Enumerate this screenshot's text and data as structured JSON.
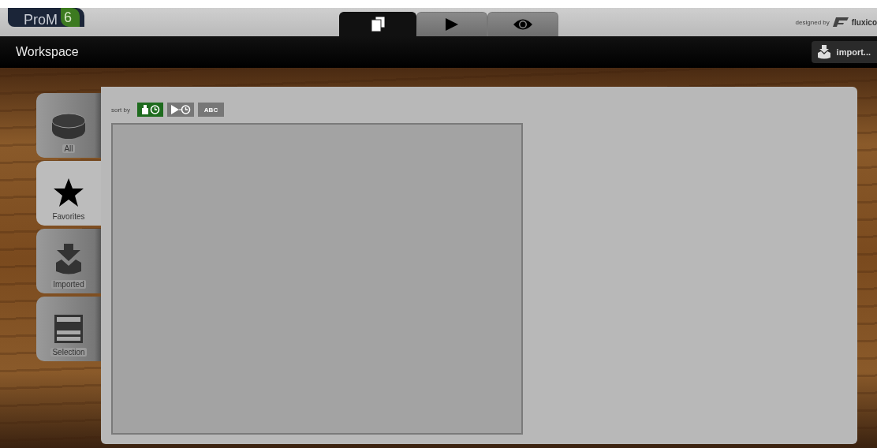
{
  "header": {
    "logo": {
      "name": "ProM",
      "version": "6"
    },
    "mode_tabs": [
      {
        "kind": "workspace",
        "selected": true
      },
      {
        "kind": "run",
        "selected": false
      },
      {
        "kind": "view",
        "selected": false
      }
    ],
    "credit": {
      "prefix": "designed by",
      "brand": "fluxico"
    }
  },
  "title_bar": {
    "title": "Workspace",
    "import_button": "import..."
  },
  "sidebar": [
    {
      "kind": "all",
      "label": "All",
      "selected": false
    },
    {
      "kind": "favorites",
      "label": "Favorites",
      "selected": true
    },
    {
      "kind": "imported",
      "label": "Imported",
      "selected": false
    },
    {
      "kind": "selection",
      "label": "Selection",
      "selected": false
    }
  ],
  "sort": {
    "label": "sort by",
    "options": [
      {
        "kind": "imported-time",
        "selected": true
      },
      {
        "kind": "played-time",
        "selected": false
      },
      {
        "kind": "text",
        "label": "ABC",
        "selected": false
      }
    ]
  }
}
